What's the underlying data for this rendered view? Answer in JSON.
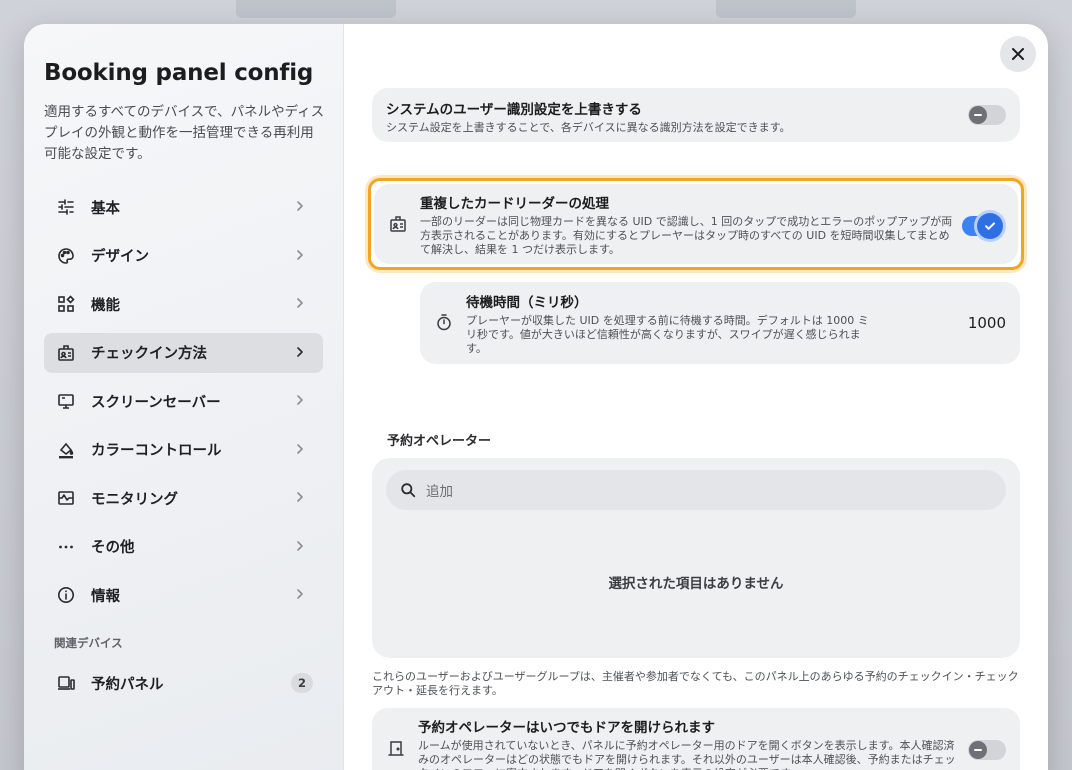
{
  "window": {
    "title": "Booking panel config",
    "description": "適用するすべてのデバイスで、パネルやディスプレイの外観と動作を一括管理できる再利用可能な設定です。"
  },
  "sidebar": {
    "items": [
      {
        "label": "基本",
        "icon": "sliders-icon"
      },
      {
        "label": "デザイン",
        "icon": "palette-icon"
      },
      {
        "label": "機能",
        "icon": "widgets-icon"
      },
      {
        "label": "チェックイン方法",
        "icon": "badge-icon",
        "active": true
      },
      {
        "label": "スクリーンセーバー",
        "icon": "monitor-icon"
      },
      {
        "label": "カラーコントロール",
        "icon": "paint-bucket-icon"
      },
      {
        "label": "モニタリング",
        "icon": "monitoring-icon"
      },
      {
        "label": "その他",
        "icon": "more-icon"
      },
      {
        "label": "情報",
        "icon": "info-icon"
      }
    ],
    "related_label": "関連デバイス",
    "devices": [
      {
        "label": "予約パネル",
        "count": "2"
      }
    ]
  },
  "main": {
    "override": {
      "title": "システムのユーザー識別設定を上書きする",
      "subtitle": "システム設定を上書きすることで、各デバイスに異なる識別方法を設定できます。",
      "enabled": false
    },
    "duplicate": {
      "title": "重複したカードリーダーの処理",
      "subtitle": "一部のリーダーは同じ物理カードを異なる UID で認識し、1 回のタップで成功とエラーのポップアップが両方表示されることがあります。有効にするとプレーヤーはタップ時のすべての UID を短時間収集してまとめて解決し、結果を 1 つだけ表示します。",
      "enabled": true
    },
    "wait": {
      "title": "待機時間（ミリ秒）",
      "subtitle": "プレーヤーが収集した UID を処理する前に待機する時間。デフォルトは 1000 ミリ秒です。値が大きいほど信頼性が高くなりますが、スワイプが遅く感じられます。",
      "value": "1000"
    },
    "operators": {
      "label": "予約オペレーター",
      "search_placeholder": "追加",
      "empty": "選択された項目はありません",
      "help": "これらのユーザーおよびユーザーグループは、主催者や参加者でなくても、このパネル上のあらゆる予約のチェックイン・チェックアウト・延長を行えます。"
    },
    "door": {
      "title": "予約オペレーターはいつでもドアを開けられます",
      "subtitle": "ルームが使用されていないとき、パネルに予約オペレーター用のドアを開くボタンを表示します。本人確認済みのオペレーターはどの状態でもドアを開けられます。それ以外のユーザーは本人確認後、予約またはチェックインのフローに案内されます。ドアを開くボタンを表示の設定が必要です。",
      "enabled": false
    }
  },
  "colors": {
    "accent": "#2f6fe4",
    "focus": "#f0a524",
    "card": "#eff0f2"
  }
}
